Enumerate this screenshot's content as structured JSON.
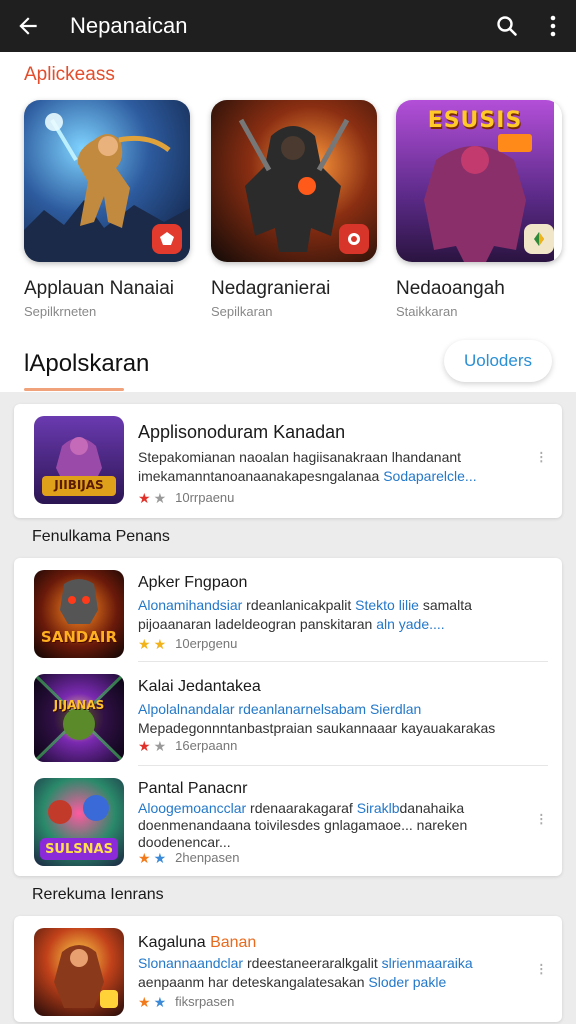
{
  "topbar": {
    "title": "Nepanaican"
  },
  "featured": {
    "heading": "Aplickeass",
    "tiles": [
      {
        "name": "Applauan Nanaiai",
        "sub": "Sepilkrneten"
      },
      {
        "name": "Nedagranierai",
        "sub": "Sepilkaran"
      },
      {
        "name": "Nedaoangah",
        "sub": "Staikkaran"
      }
    ],
    "tile3_banner": "ESUSIS"
  },
  "section": {
    "title": "lApolskaran",
    "button": "Uoloders"
  },
  "top_item": {
    "title": "Applisonoduram Kanadan",
    "desc1": "Stepakomianan naoalan hagiisanakraan lhandanant",
    "desc2a": "imekamanntanoanaanakapesngalanaa ",
    "desc2b": "Sodaparelcle...",
    "rating": "10rrpaenu",
    "thumb_label": "JIIBIJAS"
  },
  "group1": {
    "label": "Fenulkama Penans",
    "items": [
      {
        "title": "Apker Fngpaon",
        "desc1a": "Alonamihandsiar",
        "desc1b": " rdeanlanicakpalit ",
        "desc1c": "Stekto lilie",
        "desc1d": " samalta",
        "desc2a": "pijoaanaran ladeldeogran panskitaran ",
        "desc2b": "aln yade....",
        "rating": "10erpgenu",
        "thumb_label": "SANDAIR"
      },
      {
        "title": "Kalai Jedantakea",
        "desc1a": "Alpolalnandalar rdeanlanarnelsabam ",
        "desc1b": "Sierdlan",
        "desc2": "Mepadegonnntanbastpraian saukannaaar kayauakarakas",
        "rating": "16erpaann",
        "thumb_label": "JIJANAS"
      },
      {
        "title": "Pantal Panacnr",
        "desc1a": "Aloogemoancclar",
        "desc1b": " rdenaarakagaraf ",
        "desc1c": "Siraklb",
        "desc1d": "danahaika",
        "desc2a": "doenmenandaana toivilesdes gnlagamaoe",
        "desc2b": "... nareken",
        "desc3": "doodenencar...",
        "rating": "2henpasen",
        "thumb_label": "SULSNAS"
      }
    ]
  },
  "group2": {
    "label": "Rerekuma Ienrans",
    "items": [
      {
        "title_a": "Kagaluna ",
        "title_b": "Banan",
        "desc1a": "Slonannaandclar",
        "desc1b": " rdeestaneeraralkgalit ",
        "desc1c": "slrienmaaraika",
        "desc2a": "aenpaanm har deteskangalatesakan ",
        "desc2b": "Sloder pakle",
        "rating": "fiksrpasen"
      }
    ]
  },
  "colors": {
    "accent": "#e34d2b",
    "link": "#2378c9",
    "topbar": "#1f1f1f"
  }
}
